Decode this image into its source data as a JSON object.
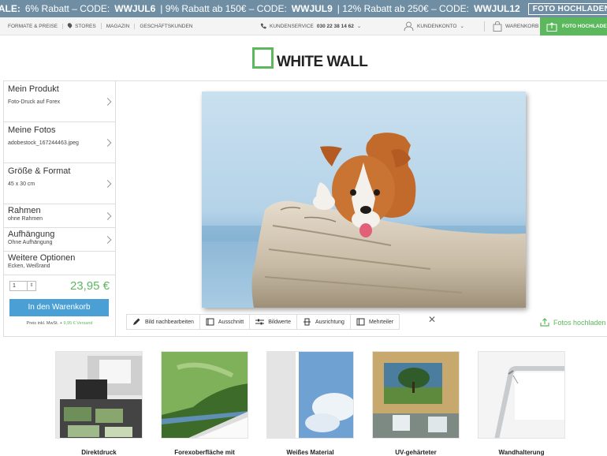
{
  "sale_banner": {
    "sale_label": "SALE:",
    "t1": "6% Rabatt – CODE:",
    "c1": "WWJUL6",
    "t2": "| 9% Rabatt ab 150€ – CODE:",
    "c2": "WWJUL9",
    "t3": "| 12% Rabatt ab 250€ – CODE:",
    "c3": "WWJUL12",
    "upload_button": "FOTO HOCHLADEN"
  },
  "top_nav": {
    "formats": "FORMATE & PREISE",
    "stores": "STORES",
    "magazine": "MAGAZIN",
    "business": "GESCHÄFTSKUNDEN",
    "service_label": "KUNDENSERVICE",
    "service_phone": "030 22 38 14 62",
    "account": "KUNDENKONTO",
    "cart": "WARENKORB",
    "upload": "FOTO HOCHLADE"
  },
  "logo": {
    "text": "WHITE WALL"
  },
  "config": {
    "items": [
      {
        "title": "Mein Produkt",
        "value": "Foto-Druck auf Forex"
      },
      {
        "title": "Meine Fotos",
        "value": "adobestock_167244463.jpeg"
      },
      {
        "title": "Größe & Format",
        "value": "45 x 30 cm"
      },
      {
        "title": "Rahmen",
        "value": "ohne Rahmen"
      },
      {
        "title": "Aufhängung",
        "value": "Ohne Aufhängung"
      },
      {
        "title": "Weitere Optionen",
        "value": "Ecken, Weißrand"
      }
    ],
    "quantity": "1",
    "price": "23,95 €",
    "add_to_cart": "In den Warenkorb",
    "vat_text": "Preis inkl. MwSt. +",
    "shipping": "9,95 € Versand"
  },
  "toolbar": {
    "edit": "Bild nachbearbeiten",
    "crop": "Ausschnitt",
    "values": "Bildwerte",
    "orientation": "Ausrichtung",
    "multipart": "Mehrteiler",
    "close": "✕",
    "upload_photos": "Fotos hochladen"
  },
  "features": [
    {
      "caption": "Direktdruck"
    },
    {
      "caption": "Forexoberfläche mit"
    },
    {
      "caption": "Weißes Material"
    },
    {
      "caption": "UV-gehärteter"
    },
    {
      "caption": "Wandhalterung"
    }
  ],
  "colors": {
    "accent_green": "#5cb85c",
    "button_blue": "#4a9fd5",
    "sale_bar": "#6f8ea4"
  }
}
